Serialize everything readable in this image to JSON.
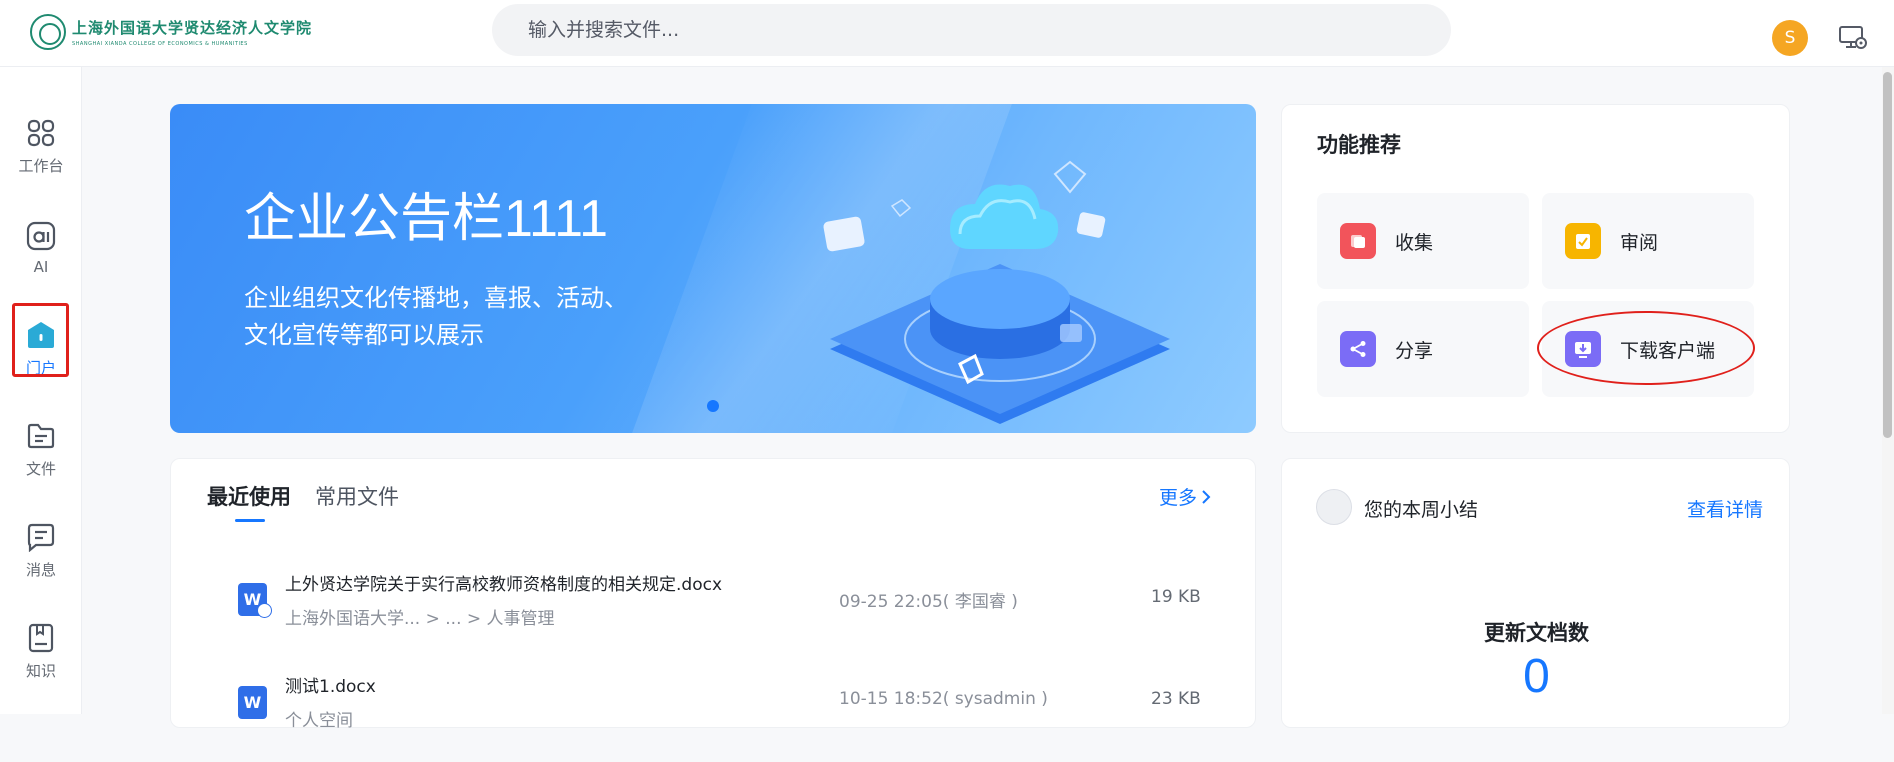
{
  "header": {
    "logo_text_cn": "上海外国语大学贤达经济人文学院",
    "logo_text_en": "SHANGHAI XIANDA COLLEGE OF ECONOMICS & HUMANITIES",
    "search_placeholder": "输入并搜索文件...",
    "avatar_initial": "S"
  },
  "sidebar": {
    "items": [
      {
        "label": "工作台",
        "icon": "grid-icon"
      },
      {
        "label": "AI",
        "icon": "ai-icon"
      },
      {
        "label": "门户",
        "icon": "home-icon",
        "active": true
      },
      {
        "label": "文件",
        "icon": "folder-icon"
      },
      {
        "label": "消息",
        "icon": "message-icon"
      },
      {
        "label": "知识",
        "icon": "book-icon"
      }
    ]
  },
  "banner": {
    "title": "企业公告栏1111",
    "subtitle_line1": "企业组织文化传播地，喜报、活动、",
    "subtitle_line2": "文化宣传等都可以展示"
  },
  "features": {
    "title": "功能推荐",
    "items": [
      {
        "label": "收集",
        "icon": "collect-icon",
        "color": "#f2545b"
      },
      {
        "label": "审阅",
        "icon": "review-icon",
        "color": "#f7b500"
      },
      {
        "label": "分享",
        "icon": "share-icon",
        "color": "#7b6cf6"
      },
      {
        "label": "下载客户端",
        "icon": "download-client-icon",
        "color": "#7b6cf6"
      }
    ]
  },
  "recent": {
    "tabs": [
      "最近使用",
      "常用文件"
    ],
    "more": "更多",
    "files": [
      {
        "name": "上外贤达学院关于实行高校教师资格制度的相关规定.docx",
        "path": "上海外国语大学...   >   ...   >   人事管理",
        "time": "09-25 22:05( 李国睿 )",
        "size": "19 KB"
      },
      {
        "name": "测试1.docx",
        "path": "个人空间",
        "time": "10-15 18:52( sysadmin )",
        "size": "23 KB"
      }
    ]
  },
  "summary": {
    "title": "您的本周小结",
    "detail_link": "查看详情",
    "metric_label": "更新文档数",
    "metric_value": "0"
  },
  "colors": {
    "accent": "#1677ff",
    "highlight_red": "#e0201b",
    "avatar_bg": "#f5a623"
  }
}
